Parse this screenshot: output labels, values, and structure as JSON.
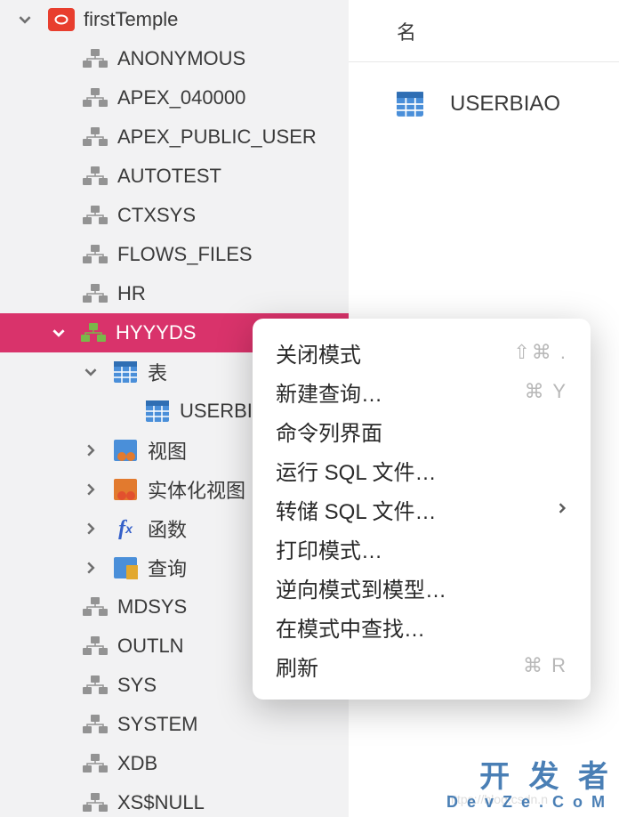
{
  "connection": {
    "name": "firstTemple"
  },
  "schemas": [
    {
      "name": "ANONYMOUS"
    },
    {
      "name": "APEX_040000"
    },
    {
      "name": "APEX_PUBLIC_USER"
    },
    {
      "name": "AUTOTEST"
    },
    {
      "name": "CTXSYS"
    },
    {
      "name": "FLOWS_FILES"
    },
    {
      "name": "HR"
    }
  ],
  "selected_schema": {
    "name": "HYYYDS"
  },
  "schema_children": {
    "tables": {
      "label": "表",
      "items": [
        {
          "name": "USERBIAO"
        }
      ]
    },
    "views": {
      "label": "视图"
    },
    "mviews": {
      "label": "实体化视图"
    },
    "functions": {
      "label": "函数"
    },
    "queries": {
      "label": "查询"
    }
  },
  "schemas_after": [
    {
      "name": "MDSYS"
    },
    {
      "name": "OUTLN"
    },
    {
      "name": "SYS"
    },
    {
      "name": "SYSTEM"
    },
    {
      "name": "XDB"
    },
    {
      "name": "XS$NULL"
    }
  ],
  "main": {
    "column_header": "名",
    "table_name": "USERBIAO"
  },
  "context_menu": {
    "items": [
      {
        "label": "关闭模式",
        "shortcut": "⇧⌘ ."
      },
      {
        "label": "新建查询…",
        "shortcut": "⌘ Y"
      },
      {
        "label": "命令列界面",
        "shortcut": ""
      },
      {
        "label": "运行 SQL 文件…",
        "shortcut": ""
      },
      {
        "label": "转储 SQL 文件…",
        "shortcut": "",
        "submenu": true
      },
      {
        "label": "打印模式…",
        "shortcut": ""
      },
      {
        "label": "逆向模式到模型…",
        "shortcut": ""
      },
      {
        "label": "在模式中查找…",
        "shortcut": ""
      },
      {
        "label": "刷新",
        "shortcut": "⌘ R"
      }
    ]
  },
  "watermark": {
    "line1": "开 发 者",
    "line2": "DevZe.CoM"
  },
  "blog_watermark": "https://blog.csdn.n"
}
